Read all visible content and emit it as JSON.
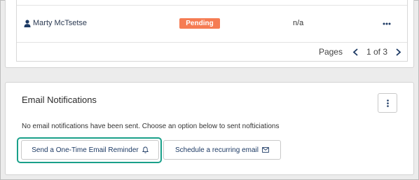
{
  "table": {
    "row": {
      "user_name": "Marty McTsetse",
      "status": "Pending",
      "value": "n/a",
      "more_icon": "ellipsis-icon",
      "user_icon": "user-icon"
    },
    "pagination": {
      "label": "Pages",
      "indicator": "1 of 3",
      "prev_icon": "chevron-left-icon",
      "next_icon": "chevron-right-icon"
    }
  },
  "email_notifications": {
    "title": "Email Notifications",
    "menu_icon": "vertical-ellipsis-icon",
    "status_text": "No email notifications have been sent. Choose an option below to sent nofticiations",
    "buttons": {
      "one_time": {
        "label": "Send a One-Time Email Reminder",
        "icon": "bell-icon"
      },
      "recurring": {
        "label": "Schedule a recurring email",
        "icon": "envelope-icon"
      }
    }
  },
  "colors": {
    "status_badge": "#f57c53",
    "highlight": "#1aa08a",
    "button_text": "#1d3a64",
    "page_background": "#ececec"
  }
}
